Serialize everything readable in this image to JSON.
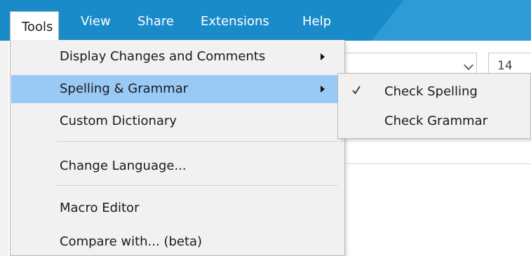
{
  "menubar": {
    "items": [
      {
        "label": "Tools"
      },
      {
        "label": "View"
      },
      {
        "label": "Share"
      },
      {
        "label": "Extensions"
      },
      {
        "label": "Help"
      }
    ]
  },
  "toolbar": {
    "font_size_value": "14"
  },
  "tools_menu": {
    "items": [
      {
        "label": "Display Changes and Comments"
      },
      {
        "label": "Spelling & Grammar"
      },
      {
        "label": "Custom Dictionary"
      },
      {
        "label": "Change Language..."
      },
      {
        "label": "Macro Editor"
      },
      {
        "label": "Compare with... (beta)"
      }
    ]
  },
  "spelling_submenu": {
    "items": [
      {
        "label": "Check Spelling",
        "checked": true
      },
      {
        "label": "Check Grammar",
        "checked": false
      }
    ]
  },
  "colors": {
    "menubar": "#1a8bc9",
    "highlight": "#99c9f5",
    "menu_background": "#f1f1f1"
  },
  "icons": {
    "submenu_arrow": "triangle-right-icon",
    "checkmark": "check-icon"
  }
}
